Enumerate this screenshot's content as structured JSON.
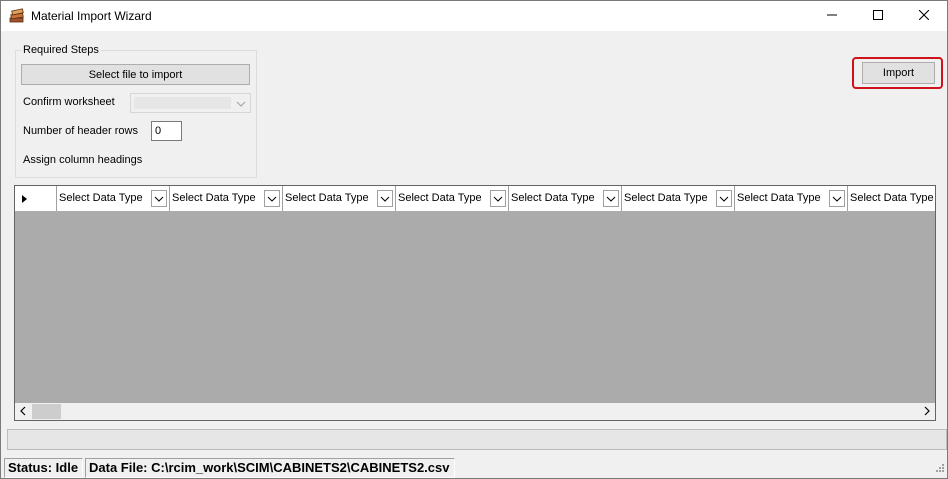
{
  "window": {
    "title": "Material Import Wizard",
    "app_icon": "stacked-books-icon",
    "caption_buttons": [
      "minimize-icon",
      "maximize-icon",
      "close-icon"
    ]
  },
  "required_steps": {
    "group_title": "Required Steps",
    "select_file_button": "Select file to import",
    "confirm_worksheet_label": "Confirm worksheet",
    "confirm_worksheet_value": "",
    "header_rows_label": "Number of header rows",
    "header_rows_value": "0",
    "assign_headings_label": "Assign column headings"
  },
  "import_button": "Import",
  "accent_colors": {
    "highlight": "#d0121b",
    "grid_background": "#ababab"
  },
  "grid": {
    "columns": [
      "Select Data Type",
      "Select Data Type",
      "Select Data Type",
      "Select Data Type",
      "Select Data Type",
      "Select Data Type",
      "Select Data Type",
      "Select Data Type"
    ]
  },
  "progress": {
    "fraction": 0
  },
  "status_bar": {
    "status": "Status: Idle",
    "data_file": "Data File: C:\\rcim_work\\SCIM\\CABINETS2\\CABINETS2.csv"
  }
}
